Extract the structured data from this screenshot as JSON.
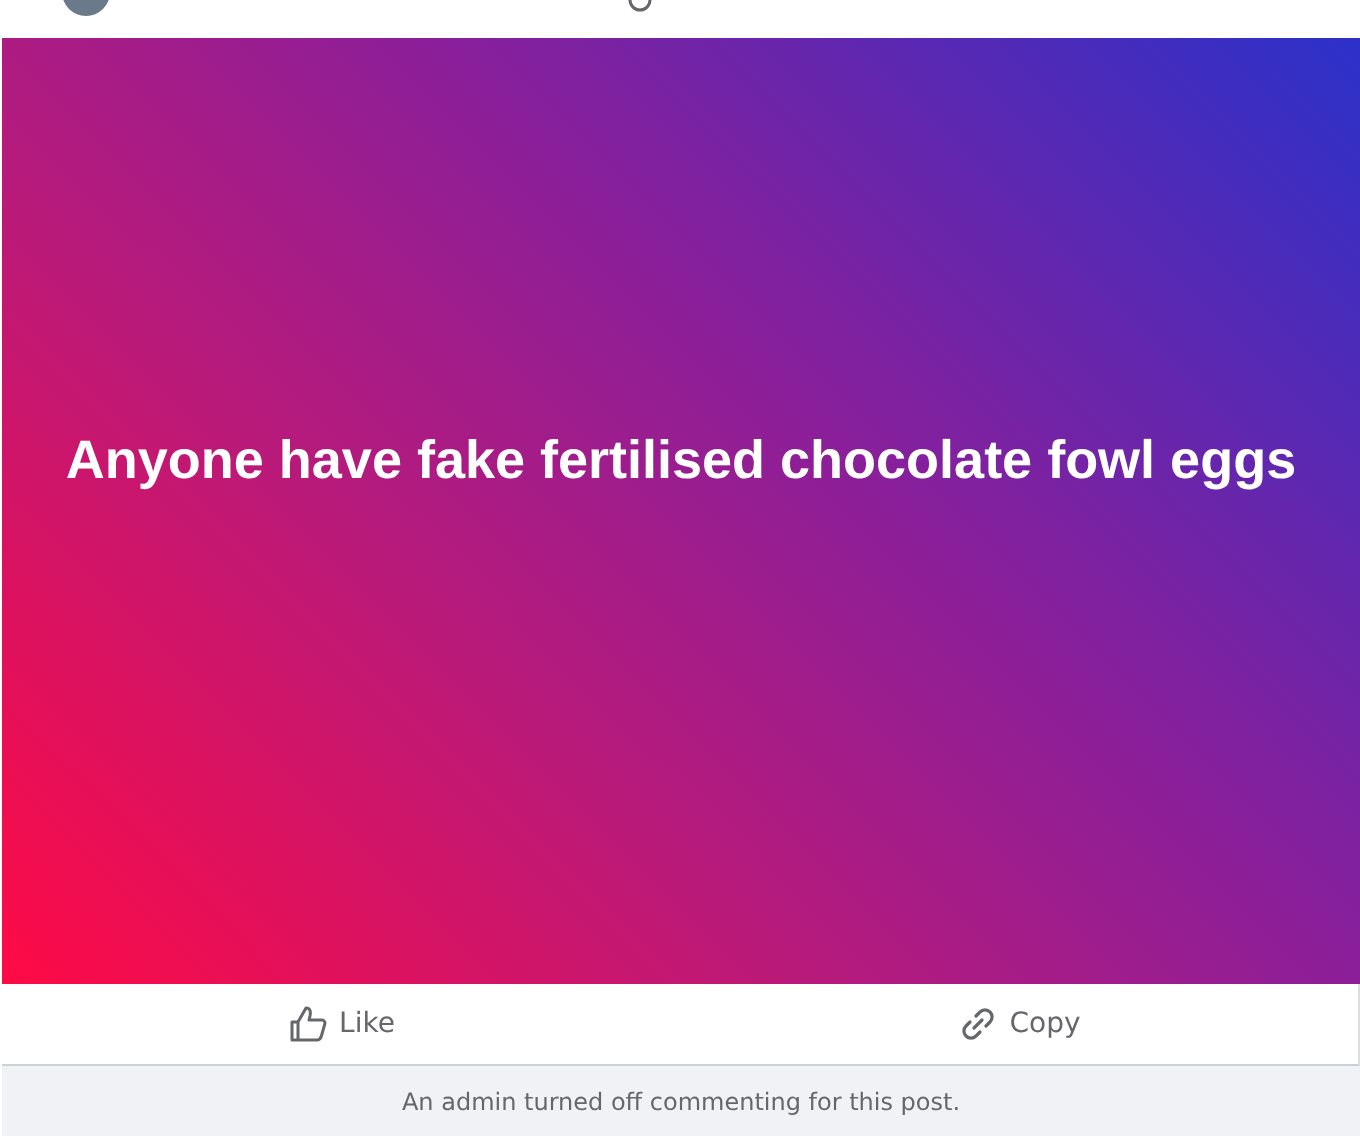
{
  "post": {
    "text": "Anyone have fake fertilised chocolate fowl eggs"
  },
  "actions": [
    {
      "kind": "like",
      "label": "Like"
    },
    {
      "kind": "copy",
      "label": "Copy"
    }
  ],
  "notice": "An admin turned off commenting for this post."
}
